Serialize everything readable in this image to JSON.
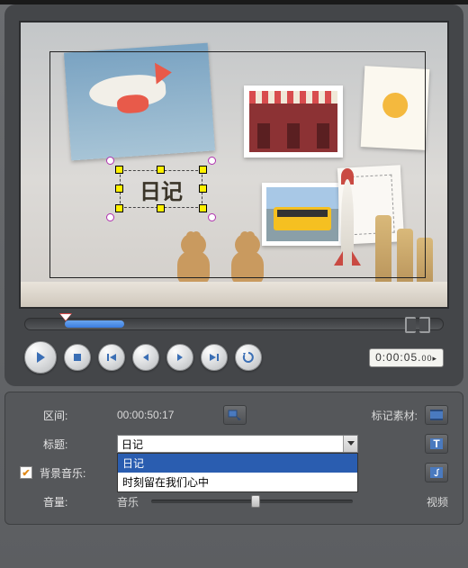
{
  "preview": {
    "selected_text": "日记"
  },
  "timecode": {
    "display_main": "0:00:05.",
    "display_frac": "00",
    "play_icon_suffix": "▸"
  },
  "properties": {
    "section_label": "区间:",
    "section_value": "00:00:50:17",
    "mark_material_label": "标记素材:",
    "title_label": "标题:",
    "title_value": "日记",
    "title_options": [
      "日记",
      "时刻留在我们心中"
    ],
    "bgm_label": "背景音乐:",
    "bgm_checked": true,
    "volume_label": "音量:",
    "volume_left": "音乐",
    "volume_right": "视频",
    "volume_pos_pct": 52
  }
}
